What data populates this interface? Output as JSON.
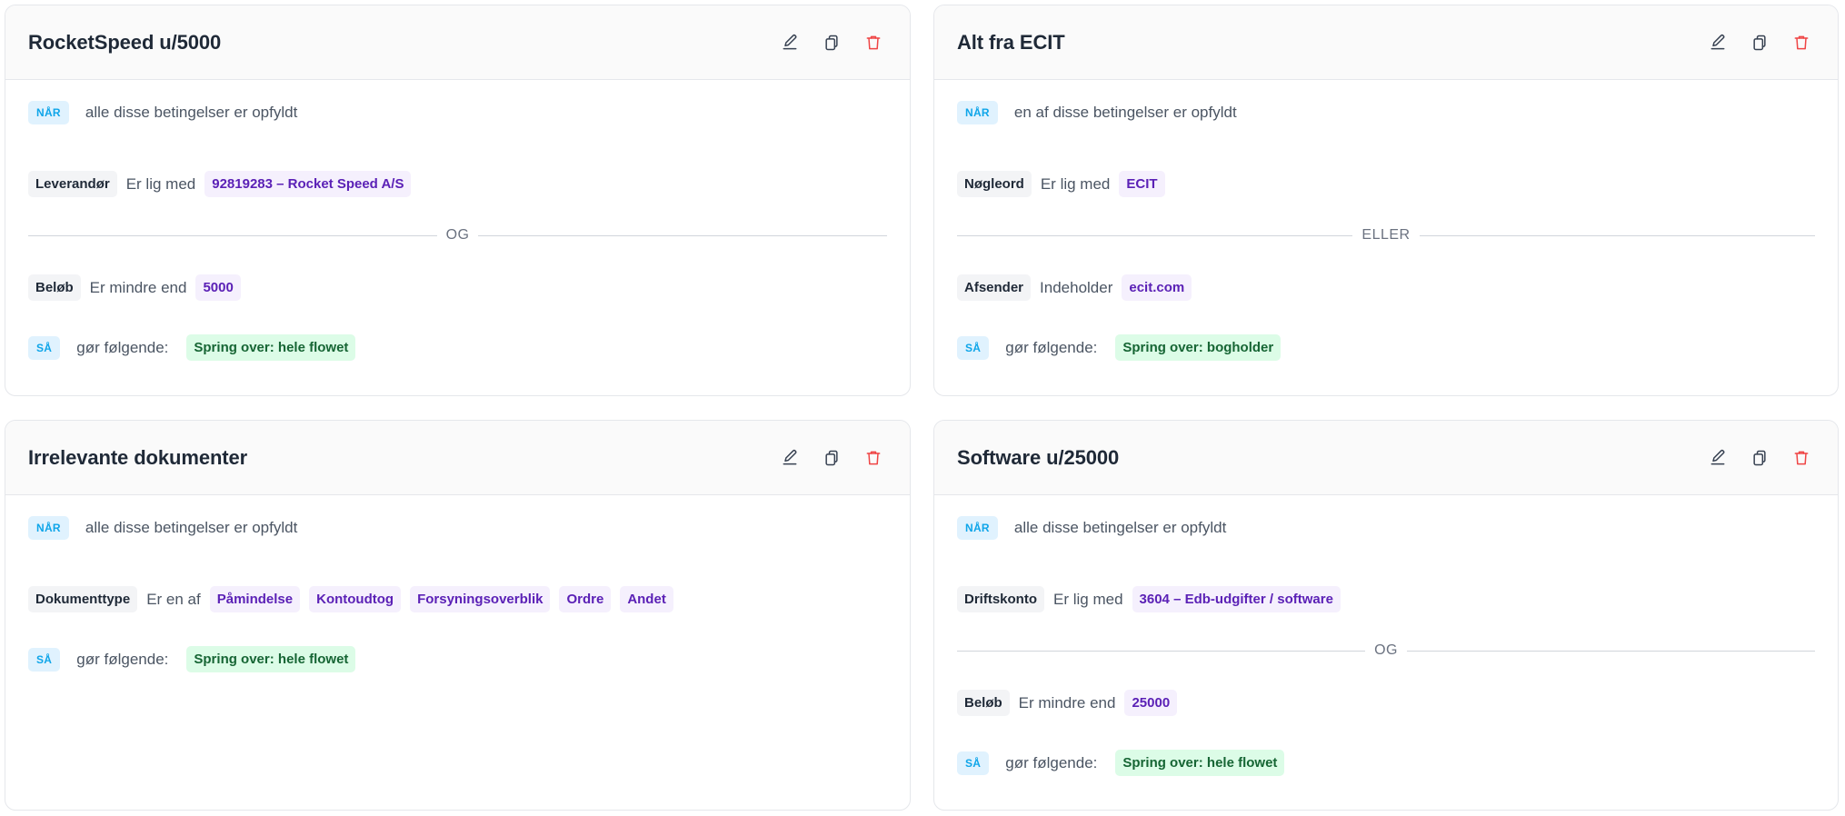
{
  "colors": {
    "keyword_bg": "#e0f2fe",
    "keyword_fg": "#0ea5e9",
    "value_bg": "#f5f0fd",
    "value_fg": "#5b21b6",
    "action_bg": "#dcfce7",
    "action_fg": "#166534",
    "delete_icon": "#ef4444"
  },
  "icons": {
    "edit": "pencil-icon",
    "copy": "copy-icon",
    "delete": "trash-icon"
  },
  "rules": [
    {
      "title": "RocketSpeed u/5000",
      "when_label": "NÅR",
      "when_text": "alle disse betingelser er opfyldt",
      "conditions": [
        {
          "field": "Leverandør",
          "operator": "Er lig med",
          "values": [
            "92819283 – Rocket Speed A/S"
          ]
        },
        {
          "field": "Beløb",
          "operator": "Er mindre end",
          "values": [
            "5000"
          ]
        }
      ],
      "joiner": "OG",
      "then_label": "SÅ",
      "then_text": "gør følgende:",
      "action": "Spring over: hele flowet"
    },
    {
      "title": "Alt fra ECIT",
      "when_label": "NÅR",
      "when_text": "en af disse betingelser er opfyldt",
      "conditions": [
        {
          "field": "Nøgleord",
          "operator": "Er lig med",
          "values": [
            "ECIT"
          ]
        },
        {
          "field": "Afsender",
          "operator": "Indeholder",
          "values": [
            "ecit.com"
          ]
        }
      ],
      "joiner": "ELLER",
      "then_label": "SÅ",
      "then_text": "gør følgende:",
      "action": "Spring over: bogholder"
    },
    {
      "title": "Irrelevante dokumenter",
      "when_label": "NÅR",
      "when_text": "alle disse betingelser er opfyldt",
      "conditions": [
        {
          "field": "Dokumenttype",
          "operator": "Er en af",
          "values": [
            "Påmindelse",
            "Kontoudtog",
            "Forsyningsoverblik",
            "Ordre",
            "Andet"
          ]
        }
      ],
      "then_label": "SÅ",
      "then_text": "gør følgende:",
      "action": "Spring over: hele flowet"
    },
    {
      "title": "Software u/25000",
      "when_label": "NÅR",
      "when_text": "alle disse betingelser er opfyldt",
      "conditions": [
        {
          "field": "Driftskonto",
          "operator": "Er lig med",
          "values": [
            "3604 – Edb-udgifter / software"
          ]
        },
        {
          "field": "Beløb",
          "operator": "Er mindre end",
          "values": [
            "25000"
          ]
        }
      ],
      "joiner": "OG",
      "then_label": "SÅ",
      "then_text": "gør følgende:",
      "action": "Spring over: hele flowet"
    }
  ]
}
